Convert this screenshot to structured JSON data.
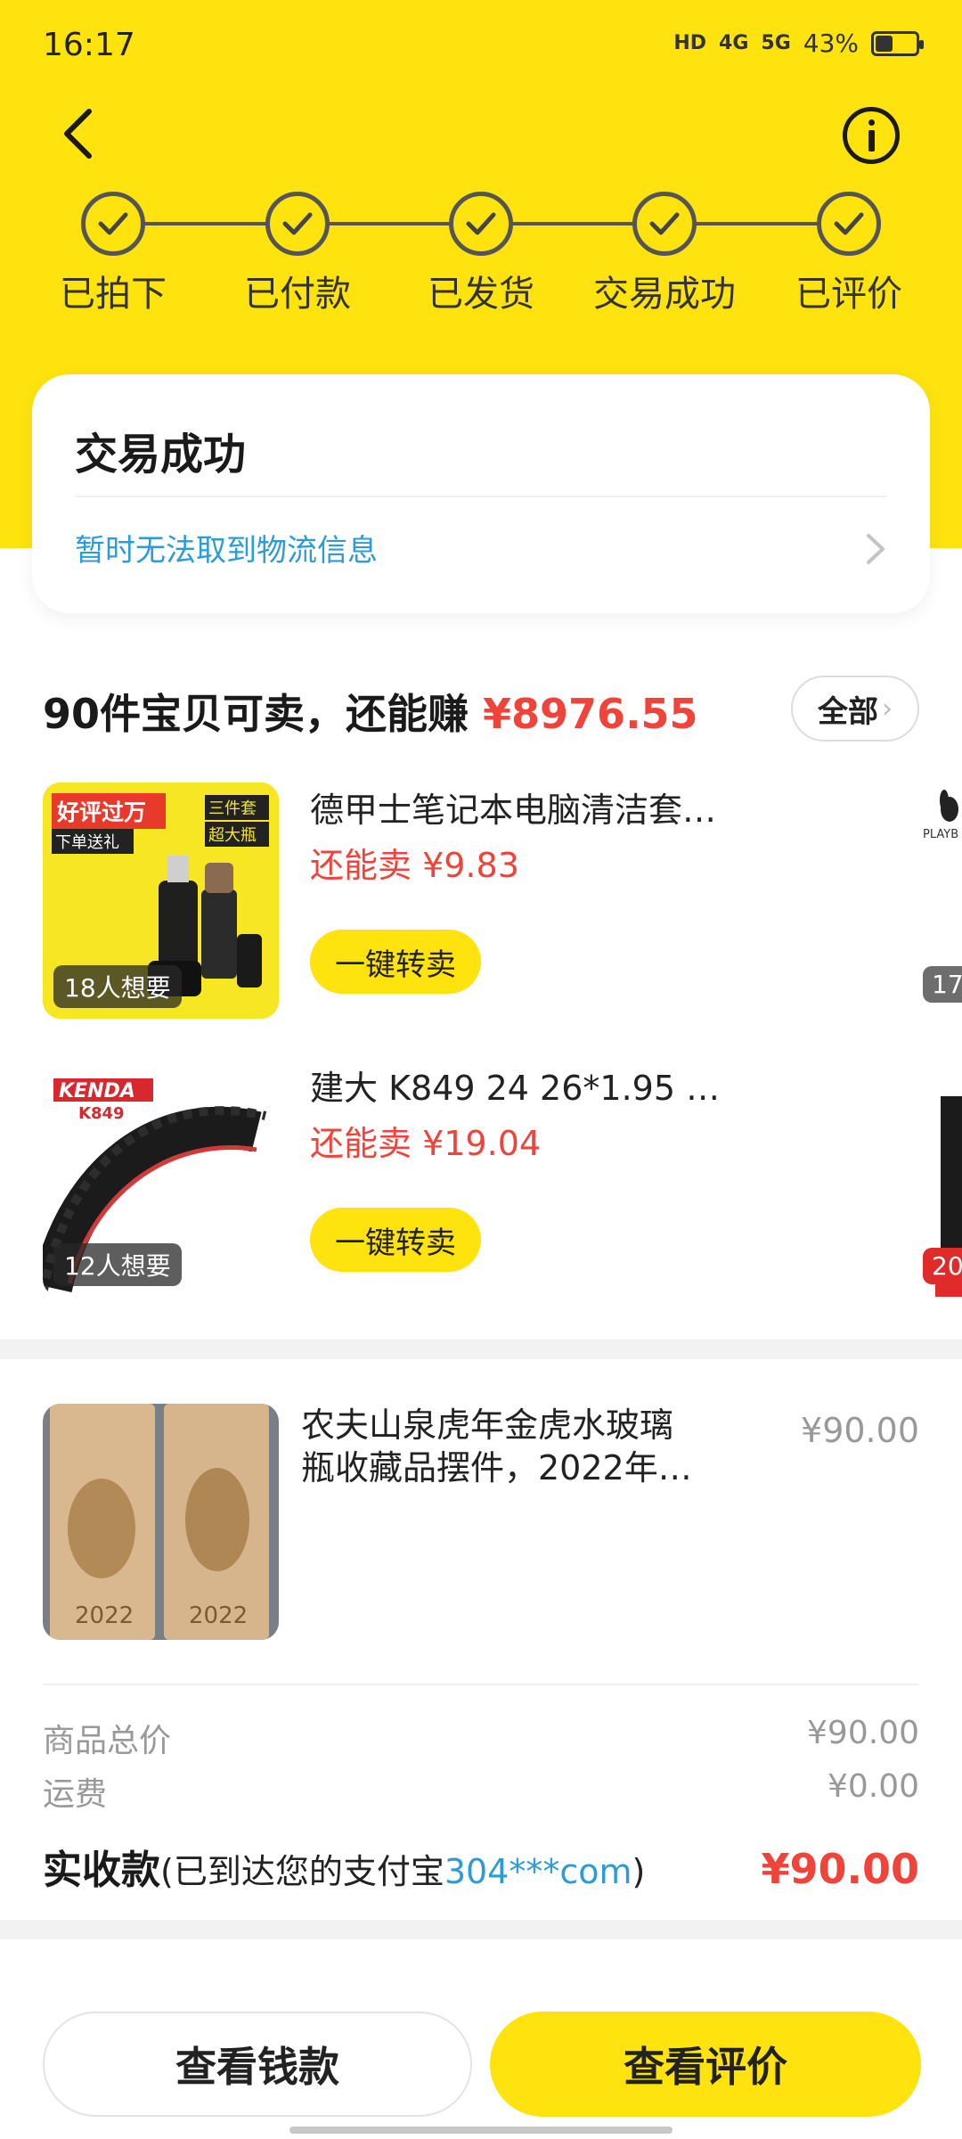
{
  "status_bar": {
    "time": "16:17",
    "hd": "HD",
    "net1": "4G",
    "net2": "5G",
    "battery_text": "43%",
    "battery_level": 0.43
  },
  "progress": {
    "steps": [
      {
        "label": "已拍下"
      },
      {
        "label": "已付款"
      },
      {
        "label": "已发货"
      },
      {
        "label": "交易成功"
      },
      {
        "label": "已评价"
      }
    ]
  },
  "status_card": {
    "title": "交易成功",
    "logistics": "暂时无法取到物流信息"
  },
  "resell": {
    "header": "90件宝贝可卖，还能赚",
    "amount": "¥8976.55",
    "all_label": "全部",
    "items": [
      {
        "name": "德甲士笔记本电脑清洁套…",
        "price": "还能卖 ¥9.83",
        "want": "18人想要",
        "button": "一键转卖",
        "thumb_tags": [
          "好评过万",
          "下单送礼",
          "三件套",
          "超大瓶"
        ]
      },
      {
        "name": "建大 K849 24 26*1.95 …",
        "price": "还能卖 ¥19.04",
        "want": "12人想要",
        "button": "一键转卖",
        "thumb_tags": [
          "KENDA",
          "K849"
        ]
      }
    ],
    "peek": [
      {
        "badge": "17",
        "brand": "PLAYB"
      },
      {
        "badge": "20"
      }
    ]
  },
  "order": {
    "name_line1": "农夫山泉虎年金虎水玻璃",
    "name_line2": "瓶收藏品摆件，2022年…",
    "price": "¥90.00",
    "bottle_year": "2022",
    "goods_total_label": "商品总价",
    "goods_total": "¥90.00",
    "shipping_label": "运费",
    "shipping": "¥0.00",
    "actual_label": "实收款",
    "actual_note_prefix": "(已到达您的支付宝",
    "alipay_account": "304***com",
    "actual_note_suffix": ")",
    "actual_amount": "¥90.00"
  },
  "actions": {
    "wallet": "查看钱款",
    "review": "查看评价"
  },
  "colors": {
    "brand_yellow": "#ffe30f",
    "price_red": "#f0433a",
    "link_blue": "#2b9cd8"
  }
}
